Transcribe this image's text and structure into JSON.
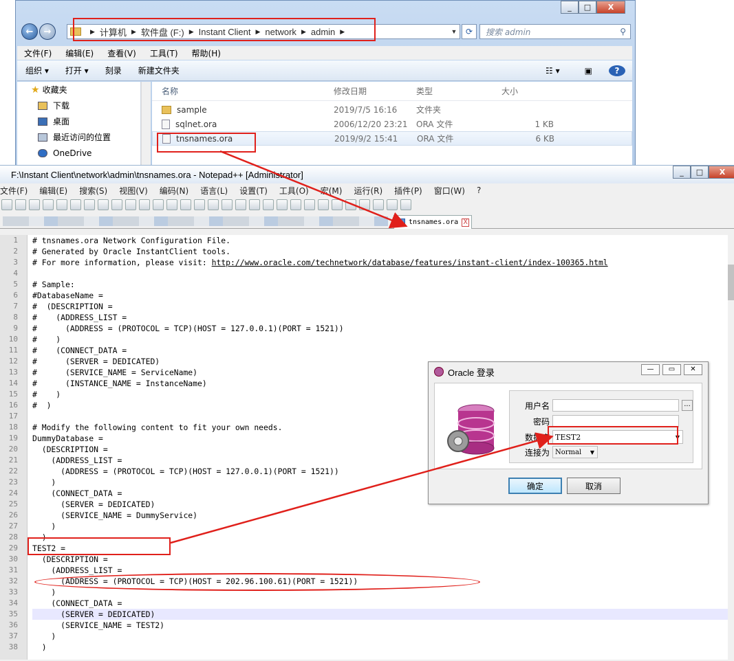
{
  "explorer": {
    "window_buttons": [
      "_",
      "□",
      "X"
    ],
    "breadcrumb": [
      "计算机",
      "软件盘 (F:)",
      "Instant Client",
      "network",
      "admin"
    ],
    "search_placeholder": "搜索 admin",
    "menu": [
      "文件(F)",
      "编辑(E)",
      "查看(V)",
      "工具(T)",
      "帮助(H)"
    ],
    "toolbar": {
      "organize": "组织 ▾",
      "open": "打开 ▾",
      "burn": "刻录",
      "new_folder": "新建文件夹",
      "help": "?"
    },
    "nav_pane": [
      "收藏夹",
      "下载",
      "桌面",
      "最近访问的位置",
      "OneDrive"
    ],
    "columns": [
      "名称",
      "修改日期",
      "类型",
      "大小"
    ],
    "files": [
      {
        "name": "sample",
        "date": "2019/7/5 16:16",
        "type": "文件夹",
        "size": ""
      },
      {
        "name": "sqlnet.ora",
        "date": "2006/12/20 23:21",
        "type": "ORA 文件",
        "size": "1 KB"
      },
      {
        "name": "tnsnames.ora",
        "date": "2019/9/2 15:41",
        "type": "ORA 文件",
        "size": "6 KB"
      }
    ]
  },
  "notepad": {
    "title": "F:\\Instant Client\\network\\admin\\tnsnames.ora - Notepad++ [Administrator]",
    "window_buttons": [
      "_",
      "□",
      "X"
    ],
    "menu": [
      "文件(F)",
      "编辑(E)",
      "搜索(S)",
      "视图(V)",
      "编码(N)",
      "语言(L)",
      "设置(T)",
      "工具(O)",
      "宏(M)",
      "运行(R)",
      "插件(P)",
      "窗口(W)",
      "?"
    ],
    "active_tab": "tnsnames.ora",
    "close_glyph": "X",
    "line_numbers": [
      "1",
      "2",
      "3",
      "4",
      "5",
      "6",
      "7",
      "8",
      "9",
      "10",
      "11",
      "12",
      "13",
      "14",
      "15",
      "16",
      "17",
      "18",
      "19",
      "20",
      "21",
      "22",
      "23",
      "24",
      "25",
      "26",
      "27",
      "28",
      "29",
      "30",
      "31",
      "32",
      "33",
      "34",
      "35",
      "36",
      "37",
      "38"
    ],
    "lines": [
      "# tnsnames.ora Network Configuration File.",
      "# Generated by Oracle InstantClient tools.",
      "# For more information, please visit: ",
      "",
      "# Sample:",
      "#DatabaseName =",
      "#  (DESCRIPTION =",
      "#    (ADDRESS_LIST =",
      "#      (ADDRESS = (PROTOCOL = TCP)(HOST = 127.0.0.1)(PORT = 1521))",
      "#    )",
      "#    (CONNECT_DATA =",
      "#      (SERVER = DEDICATED)",
      "#      (SERVICE_NAME = ServiceName)",
      "#      (INSTANCE_NAME = InstanceName)",
      "#    )",
      "#  )",
      "",
      "# Modify the following content to fit your own needs.",
      "DummyDatabase =",
      "  (DESCRIPTION =",
      "    (ADDRESS_LIST =",
      "      (ADDRESS = (PROTOCOL = TCP)(HOST = 127.0.0.1)(PORT = 1521))",
      "    )",
      "    (CONNECT_DATA =",
      "      (SERVER = DEDICATED)",
      "      (SERVICE_NAME = DummyService)",
      "    )",
      "  )",
      "TEST2 =",
      "  (DESCRIPTION =",
      "    (ADDRESS_LIST =",
      "      (ADDRESS = (PROTOCOL = TCP)(HOST = 202.96.100.61)(PORT = 1521))",
      "    )",
      "    (CONNECT_DATA =",
      "      (SERVER = DEDICATED)",
      "      (SERVICE_NAME = TEST2)",
      "    )",
      "  )"
    ],
    "line3_url": "http://www.oracle.com/technetwork/database/features/instant-client/index-100365.html"
  },
  "oracle_dialog": {
    "title": "Oracle 登录",
    "window_buttons": [
      "—",
      "▭",
      "✕"
    ],
    "username_label": "用户名",
    "username_value": "",
    "browse_button": "...",
    "password_label": "密码",
    "database_label": "数据库",
    "database_value": "TEST2",
    "connect_as_label": "连接为",
    "connect_as_value": "Normal",
    "ok_button": "确定",
    "cancel_button": "取消"
  },
  "colors": {
    "annotation_red": "#e0201b",
    "highlight_line": "#e8e8ff"
  }
}
